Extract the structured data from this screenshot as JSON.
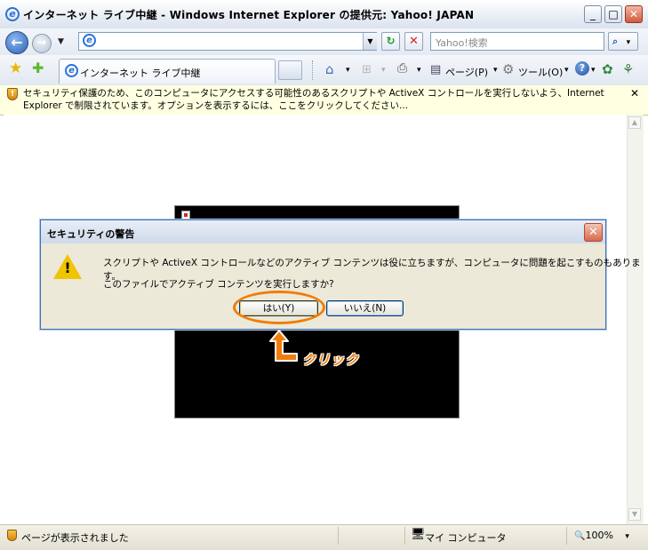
{
  "window": {
    "title": "インターネット ライブ中継 - Windows Internet Explorer の提供元: Yahoo! JAPAN",
    "minimize": "_",
    "maximize": "□",
    "close": "✕"
  },
  "navigation": {
    "back_icon": "←",
    "forward_icon": "→",
    "dropdown_icon": "▼",
    "address_value": "",
    "refresh_icon": "↻",
    "stop_icon": "✕",
    "search_placeholder": "Yahoo!検索",
    "search_icon": "⌕"
  },
  "tabs": {
    "active_tab_label": "インターネット ライブ中継"
  },
  "commands": {
    "home_icon": "⌂",
    "page_label": "ページ(P)",
    "tools_label": "ツール(O)",
    "help_icon": "?",
    "dropdown": "▾"
  },
  "infobar": {
    "text": "セキュリティ保護のため、このコンピュータにアクセスする可能性のあるスクリプトや ActiveX コントロールを実行しないよう、Internet Explorer で制限されています。オプションを表示するには、ここをクリックしてください...",
    "close": "✕"
  },
  "dialog": {
    "title": "セキュリティの警告",
    "message_line1": "スクリプトや ActiveX コントロールなどのアクティブ コンテンツは役に立ちますが、コンピュータに問題を起こすものもあります。",
    "message_line2": "このファイルでアクティブ コンテンツを実行しますか?",
    "yes_label": "はい(Y)",
    "no_label": "いいえ(N)",
    "close": "✕",
    "warning_mark": "!"
  },
  "annotation": {
    "label": "クリック",
    "color": "#f07d0a"
  },
  "statusbar": {
    "text": "ページが表示されました",
    "zone": "マイ コンピュータ",
    "zoom": "100%",
    "zoom_icon": "🔍",
    "zone_icon": "🖥"
  },
  "colors": {
    "infobar_bg": "#ffffe1",
    "dialog_bg": "#ece9d8",
    "accent": "#3c6fb4"
  }
}
